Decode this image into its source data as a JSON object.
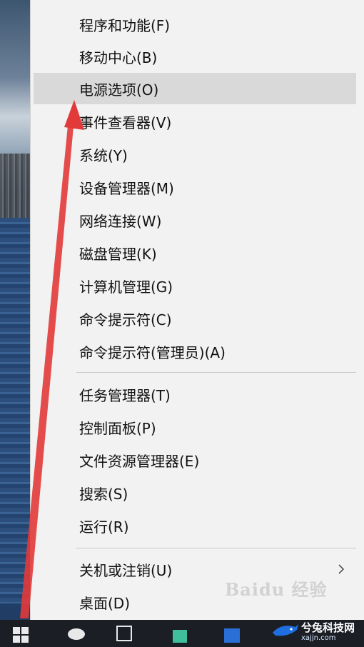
{
  "menu": {
    "items": [
      {
        "label": "程序和功能(F)"
      },
      {
        "label": "移动中心(B)"
      },
      {
        "label": "电源选项(O)"
      },
      {
        "label": "事件查看器(V)"
      },
      {
        "label": "系统(Y)"
      },
      {
        "label": "设备管理器(M)"
      },
      {
        "label": "网络连接(W)"
      },
      {
        "label": "磁盘管理(K)"
      },
      {
        "label": "计算机管理(G)"
      },
      {
        "label": "命令提示符(C)"
      },
      {
        "label": "命令提示符(管理员)(A)"
      },
      {
        "label": "任务管理器(T)"
      },
      {
        "label": "控制面板(P)"
      },
      {
        "label": "文件资源管理器(E)"
      },
      {
        "label": "搜索(S)"
      },
      {
        "label": "运行(R)"
      },
      {
        "label": "关机或注销(U)"
      },
      {
        "label": "桌面(D)"
      }
    ],
    "highlighted_item": "电源选项(O)"
  },
  "watermark": {
    "text": "Baidu 经验"
  },
  "site": {
    "line1": "兮兔科技网",
    "line2": "xajjn.com"
  },
  "colors": {
    "menu_bg": "#f2f2f2",
    "highlight": "#d9d9d9",
    "arrow": "#e23a3a",
    "taskbar": "#1b1f25"
  }
}
